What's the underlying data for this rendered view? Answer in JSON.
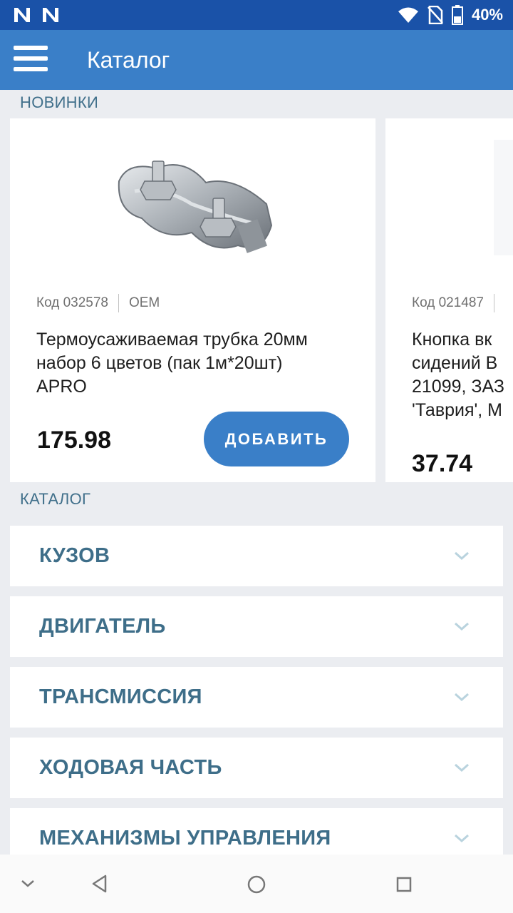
{
  "status_bar": {
    "left_icons": [
      "n-notification-icon",
      "n-notification-icon"
    ],
    "right_icons": [
      "wifi-icon",
      "no-sim-icon",
      "battery-icon"
    ],
    "battery": "40%"
  },
  "app_bar": {
    "menu_icon": "hamburger-menu-icon",
    "title": "Каталог"
  },
  "new_section": {
    "label": "НОВИНКИ",
    "products": [
      {
        "code": "Код 032578",
        "brand": "OEM",
        "name_lines": [
          "Термоусаживаемая трубка 20мм",
          "набор 6 цветов (пак 1м*20шт)",
          "APRO"
        ],
        "price": "175.98",
        "button": "ДОБАВИТЬ",
        "image_icon": "wire-rope-clamp-image"
      },
      {
        "code": "Код 021487",
        "name_lines": [
          "Кнопка вк",
          "сидений В",
          "21099, ЗАЗ",
          "'Таврия', М"
        ],
        "price": "37.74"
      }
    ]
  },
  "catalog_section": {
    "label": "КАТАЛОГ",
    "categories": [
      {
        "label": "КУЗОВ"
      },
      {
        "label": "ДВИГАТЕЛЬ"
      },
      {
        "label": "ТРАНСМИССИЯ"
      },
      {
        "label": "ХОДОВАЯ ЧАСТЬ"
      },
      {
        "label": "МЕХАНИЗМЫ УПРАВЛЕНИЯ"
      }
    ],
    "chevron_icon": "chevron-down-icon"
  },
  "nav_bar": {
    "icons": [
      "hide-keyboard-icon",
      "back-icon",
      "home-icon",
      "recents-icon"
    ]
  },
  "colors": {
    "status_bar": "#1a52a8",
    "app_bar": "#3a7fc8",
    "accent": "#3a7fc8",
    "section_label": "#41708b",
    "background": "#ebedf1"
  }
}
